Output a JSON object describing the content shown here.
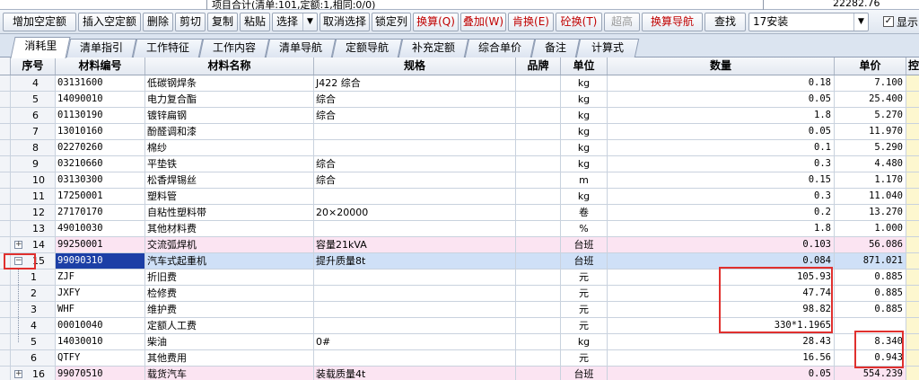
{
  "top_strip": {
    "summary": "项目合计(清单:101,定额:1,相同:0/0)",
    "amount": "22282.76"
  },
  "toolbar": {
    "buttons": [
      {
        "label": "增加空定额"
      },
      {
        "label": "插入空定额"
      },
      {
        "label": "删除"
      },
      {
        "label": "剪切"
      },
      {
        "label": "复制"
      },
      {
        "label": "粘贴"
      },
      {
        "label": "选择"
      },
      {
        "label": "取消选择"
      },
      {
        "label": "锁定列"
      },
      {
        "label": "换算(Q)"
      },
      {
        "label": "叠加(W)"
      },
      {
        "label": "肯换(E)"
      },
      {
        "label": "砼换(T)"
      },
      {
        "label": "超高"
      },
      {
        "label": "换算导航"
      },
      {
        "label": "查找"
      }
    ],
    "version_select": "17安装",
    "show_checkbox_label": "显示",
    "show_checked": true
  },
  "tabs": [
    {
      "label": "消耗里"
    },
    {
      "label": "清单指引"
    },
    {
      "label": "工作特征"
    },
    {
      "label": "工作内容"
    },
    {
      "label": "清单导航"
    },
    {
      "label": "定额导航"
    },
    {
      "label": "补充定额"
    },
    {
      "label": "综合单价"
    },
    {
      "label": "备注"
    },
    {
      "label": "计算式"
    }
  ],
  "grid": {
    "headers": {
      "seq": "序号",
      "code": "材料编号",
      "name": "材料名称",
      "spec": "规格",
      "brand": "品牌",
      "unit": "单位",
      "qty": "数量",
      "price": "单价",
      "extra": "控"
    },
    "rows": [
      {
        "seq": "4",
        "code": "03131600",
        "name": "低碳钢焊条",
        "spec": "J422 综合",
        "brand": "",
        "unit": "kg",
        "qty": "0.18",
        "price": "7.100"
      },
      {
        "seq": "5",
        "code": "14090010",
        "name": "电力复合酯",
        "spec": "综合",
        "brand": "",
        "unit": "kg",
        "qty": "0.05",
        "price": "25.400"
      },
      {
        "seq": "6",
        "code": "01130190",
        "name": "镀锌扁钢",
        "spec": "综合",
        "brand": "",
        "unit": "kg",
        "qty": "1.8",
        "price": "5.270"
      },
      {
        "seq": "7",
        "code": "13010160",
        "name": "酚醛调和漆",
        "spec": "",
        "brand": "",
        "unit": "kg",
        "qty": "0.05",
        "price": "11.970"
      },
      {
        "seq": "8",
        "code": "02270260",
        "name": "棉纱",
        "spec": "",
        "brand": "",
        "unit": "kg",
        "qty": "0.1",
        "price": "5.290"
      },
      {
        "seq": "9",
        "code": "03210660",
        "name": "平垫铁",
        "spec": "综合",
        "brand": "",
        "unit": "kg",
        "qty": "0.3",
        "price": "4.480"
      },
      {
        "seq": "10",
        "code": "03130300",
        "name": "松香焊锡丝",
        "spec": "综合",
        "brand": "",
        "unit": "m",
        "qty": "0.15",
        "price": "1.170"
      },
      {
        "seq": "11",
        "code": "17250001",
        "name": "塑料管",
        "spec": "",
        "brand": "",
        "unit": "kg",
        "qty": "0.3",
        "price": "11.040"
      },
      {
        "seq": "12",
        "code": "27170170",
        "name": "自粘性塑料带",
        "spec": "20×20000",
        "brand": "",
        "unit": "卷",
        "qty": "0.2",
        "price": "13.270"
      },
      {
        "seq": "13",
        "code": "49010030",
        "name": "其他材料费",
        "spec": "",
        "brand": "",
        "unit": "%",
        "qty": "1.8",
        "price": "1.000"
      },
      {
        "seq": "14",
        "code": "99250001",
        "name": "交流弧焊机",
        "spec": "容量21kVA",
        "brand": "",
        "unit": "台班",
        "qty": "0.103",
        "price": "56.086"
      },
      {
        "seq": "15",
        "code": "99090310",
        "name": "汽车式起重机",
        "spec": "提升质量8t",
        "brand": "",
        "unit": "台班",
        "qty": "0.084",
        "price": "871.021"
      },
      {
        "seq": "1",
        "code": "ZJF",
        "name": "折旧费",
        "spec": "",
        "brand": "",
        "unit": "元",
        "qty": "105.93",
        "price": "0.885"
      },
      {
        "seq": "2",
        "code": "JXFY",
        "name": "检修费",
        "spec": "",
        "brand": "",
        "unit": "元",
        "qty": "47.74",
        "price": "0.885"
      },
      {
        "seq": "3",
        "code": "WHF",
        "name": "维护费",
        "spec": "",
        "brand": "",
        "unit": "元",
        "qty": "98.82",
        "price": "0.885"
      },
      {
        "seq": "4",
        "code": "00010040",
        "name": "定额人工费",
        "spec": "",
        "brand": "",
        "unit": "元",
        "qty": "330*1.1965",
        "price": ""
      },
      {
        "seq": "5",
        "code": "14030010",
        "name": "柴油",
        "spec": "0#",
        "brand": "",
        "unit": "kg",
        "qty": "28.43",
        "price": "8.340"
      },
      {
        "seq": "6",
        "code": "QTFY",
        "name": "其他费用",
        "spec": "",
        "brand": "",
        "unit": "元",
        "qty": "16.56",
        "price": "0.943"
      },
      {
        "seq": "16",
        "code": "99070510",
        "name": "载货汽车",
        "spec": "装载质量4t",
        "brand": "",
        "unit": "台班",
        "qty": "0.05",
        "price": "554.239"
      }
    ]
  }
}
